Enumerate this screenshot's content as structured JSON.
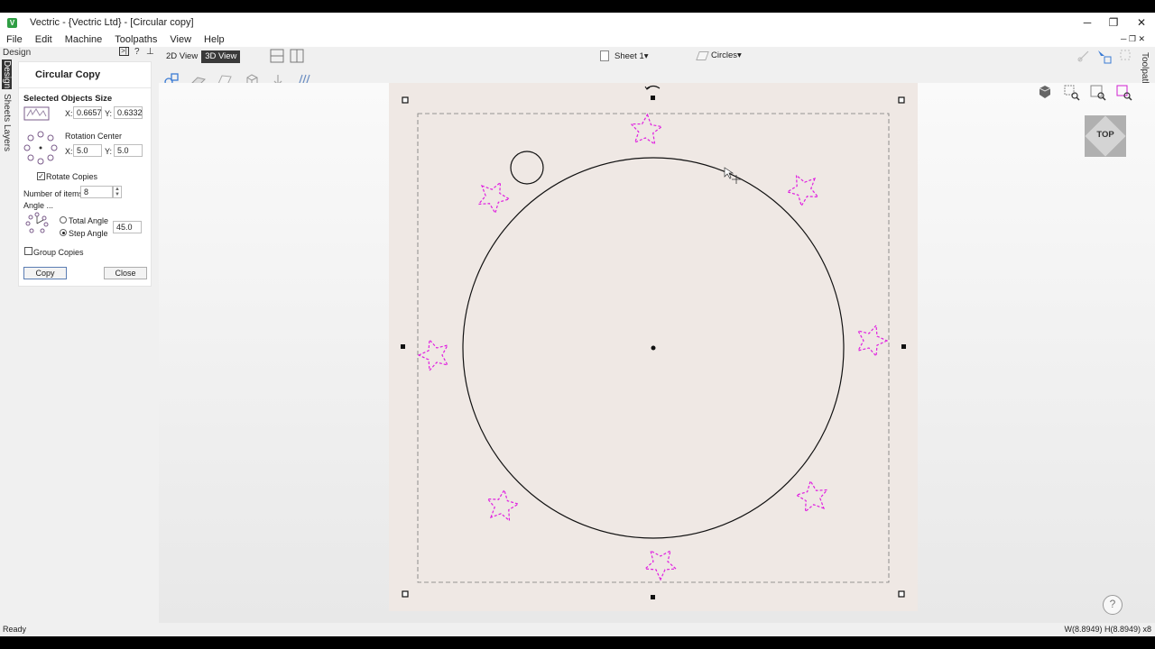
{
  "window": {
    "title": "Vectric - {Vectric Ltd} - [Circular copy]",
    "minimize_label": "─",
    "restore_label": "❐",
    "close_label": "✕"
  },
  "menu": [
    "File",
    "Edit",
    "Machine",
    "Toolpaths",
    "View",
    "Help"
  ],
  "left_tabs": [
    "Design",
    "Sheets",
    "Layers"
  ],
  "panel_header": {
    "label": "Design",
    "pin_label": "?",
    "icons": [
      "collapse-icon",
      "help-icon",
      "pin-icon"
    ]
  },
  "panel": {
    "heading": "Circular Copy",
    "selected_size": {
      "title": "Selected Objects Size",
      "x_label": "X:",
      "x_value": "0.6657",
      "y_label": "Y:",
      "y_value": "0.6332"
    },
    "rotation_center": {
      "title": "Rotation Center",
      "x_label": "X:",
      "x_value": "5.0",
      "y_label": "Y:",
      "y_value": "5.0"
    },
    "rotate_copies": {
      "label": "Rotate Copies",
      "checked": true
    },
    "number_of_items": {
      "label": "Number of items",
      "value": "8"
    },
    "angle": {
      "title": "Angle ...",
      "total_label": "Total Angle",
      "step_label": "Step Angle",
      "selected": "step",
      "value": "45.0"
    },
    "group_copies": {
      "label": "Group Copies",
      "checked": false
    },
    "copy_label": "Copy",
    "close_label": "Close"
  },
  "view_tabs": {
    "view2d": "2D View",
    "view3d": "3D View",
    "active": "3D View"
  },
  "sheet_selector": "Sheet 1",
  "layer_selector": "Circles",
  "right_strip_label": "Toolpaths",
  "view_cube_label": "TOP",
  "help_label": "?",
  "status": {
    "left": "Ready",
    "right": "W(8.8949) H(8.8949) x8"
  },
  "colors": {
    "accent": "#2f9e44",
    "selection_magenta": "#e020e0",
    "material": "#efe8e4"
  }
}
